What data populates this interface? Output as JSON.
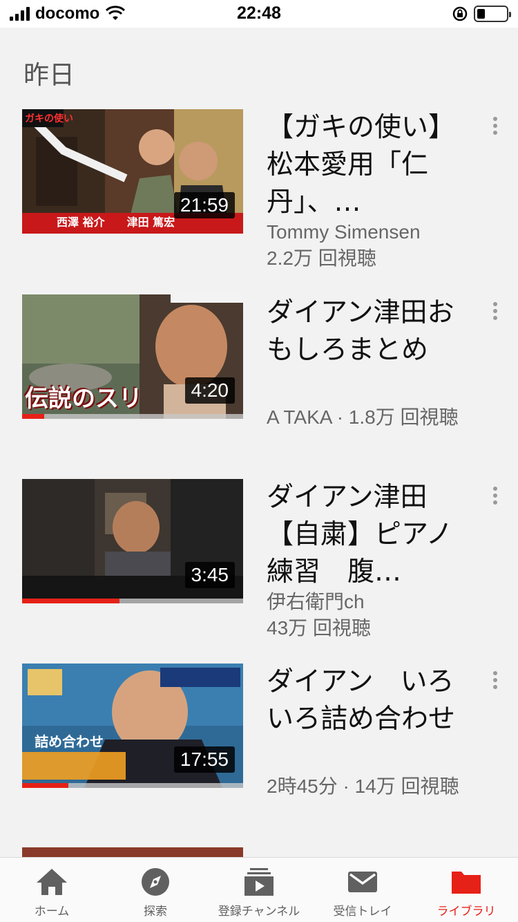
{
  "status_bar": {
    "carrier": "docomo",
    "time": "22:48"
  },
  "section": {
    "heading": "昨日"
  },
  "videos": [
    {
      "title": "【ガキの使い】松本愛用「仁丹」、…",
      "channel": "Tommy Simensen",
      "views": "2.2万 回視聴",
      "duration": "21:59",
      "progress": 1.0,
      "thumb_text": "西澤 裕介　　津田 篤宏"
    },
    {
      "title": "ダイアン津田おもしろまとめ",
      "channel_and_views": "A TAKA · 1.8万 回視聴",
      "duration": "4:20",
      "progress": 0.1,
      "thumb_text": "伝説のスリ"
    },
    {
      "title": "ダイアン津田【自粛】ピアノ練習　腹…",
      "channel": "伊右衛門ch",
      "views": "43万 回視聴",
      "duration": "3:45",
      "progress": 0.44
    },
    {
      "title": "ダイアン　いろいろ詰め合わせ",
      "channel_and_views": "2時45分 · 14万 回視聴",
      "duration": "17:55",
      "progress": 0.21,
      "thumb_text": "詰め合わせ"
    }
  ],
  "tabbar": {
    "tabs": [
      {
        "label": "ホーム",
        "icon": "home-icon"
      },
      {
        "label": "探索",
        "icon": "explore-icon"
      },
      {
        "label": "登録チャンネル",
        "icon": "subscriptions-icon"
      },
      {
        "label": "受信トレイ",
        "icon": "inbox-icon"
      },
      {
        "label": "ライブラリ",
        "icon": "library-icon",
        "active": true
      }
    ],
    "active_color": "#e62117"
  }
}
